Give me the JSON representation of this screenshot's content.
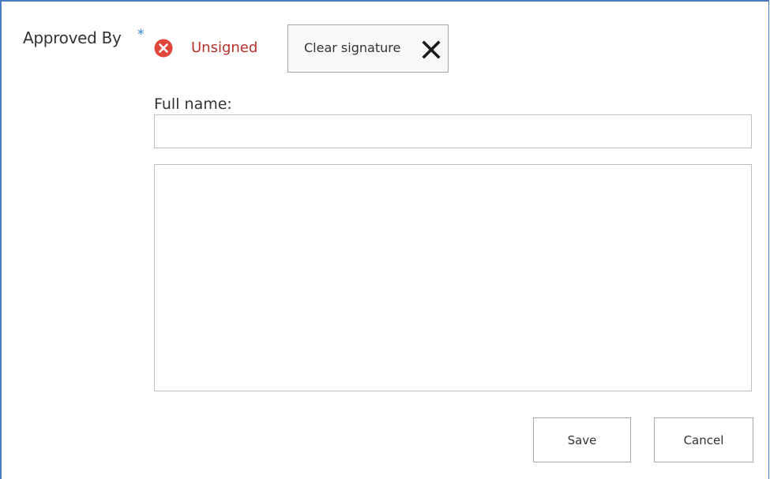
{
  "field": {
    "label": "Approved By",
    "required_marker": "*"
  },
  "status": {
    "icon": "error-circle-icon",
    "text": "Unsigned",
    "color": "#b7322c"
  },
  "clear_button": {
    "label": "Clear signature",
    "icon": "close-x-icon"
  },
  "full_name": {
    "label": "Full name:",
    "value": ""
  },
  "actions": {
    "save_label": "Save",
    "cancel_label": "Cancel"
  },
  "colors": {
    "accent_border": "#4a7cc4",
    "required_star": "#2a7fce",
    "error_icon": "#e0463a"
  }
}
